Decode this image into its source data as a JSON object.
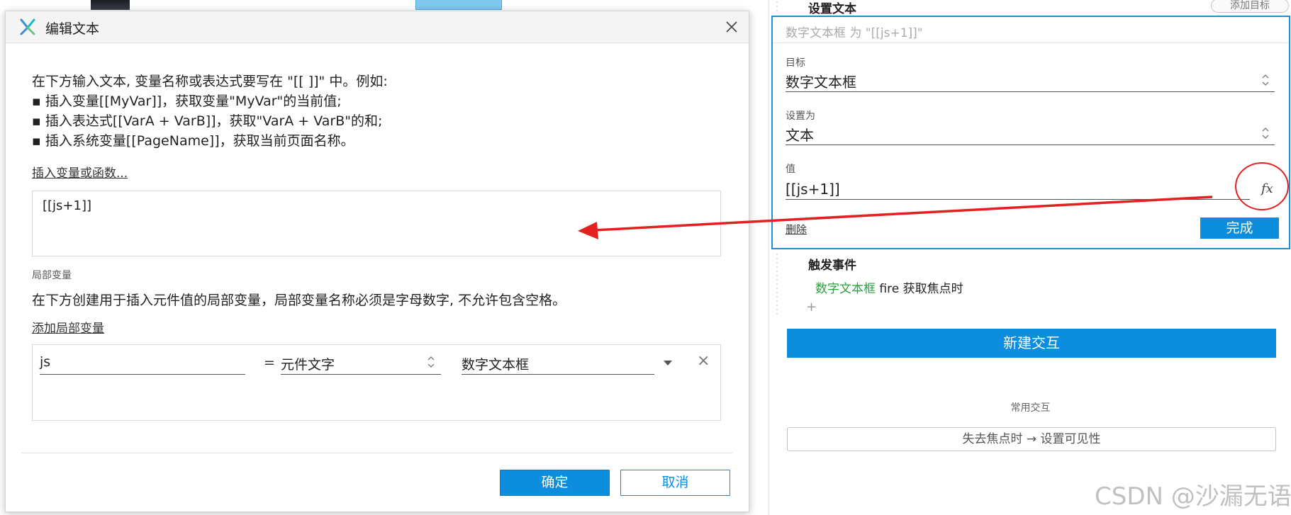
{
  "dialog": {
    "title": "编辑文本",
    "intro": [
      "在下方输入文本, 变量名称或表达式要写在 \"[[ ]]\" 中。例如:",
      "▪ 插入变量[[MyVar]]，获取变量\"MyVar\"的当前值;",
      "▪ 插入表达式[[VarA + VarB]]，获取\"VarA + VarB\"的和;",
      "▪ 插入系统变量[[PageName]]，获取当前页面名称。"
    ],
    "insert_link": "插入变量或函数...",
    "text_value": "[[js+1]]",
    "local_vars_title": "局部变量",
    "local_vars_desc": "在下方创建用于插入元件值的局部变量，局部变量名称必须是字母数字, 不允许包含空格。",
    "add_local_var": "添加局部变量",
    "var_row": {
      "name": "js",
      "equals": "=",
      "type": "元件文字",
      "target": "数字文本框",
      "remove": "×"
    },
    "ok_label": "确定",
    "cancel_label": "取消"
  },
  "panel": {
    "action_title": "设置文本",
    "add_target_label": "添加目标",
    "summary": "数字文本框 为 \"[[js+1]]\"",
    "target_label": "目标",
    "target_value": "数字文本框",
    "setto_label": "设置为",
    "setto_value": "文本",
    "value_label": "值",
    "value_text": "[[js+1]]",
    "fx_label": "fx",
    "delete_label": "删除",
    "done_label": "完成",
    "trigger_title": "触发事件",
    "trigger_target": "数字文本框",
    "trigger_event": " fire 获取焦点时",
    "add_symbol": "+",
    "new_interaction_label": "新建交互",
    "common_title": "常用交互",
    "common_action": "失去焦点时 → 设置可见性"
  },
  "watermark": "CSDN @沙漏无语",
  "colors": {
    "accent": "#0c8ddd",
    "annotation": "#e52020",
    "trigger_target": "#26a33a"
  }
}
